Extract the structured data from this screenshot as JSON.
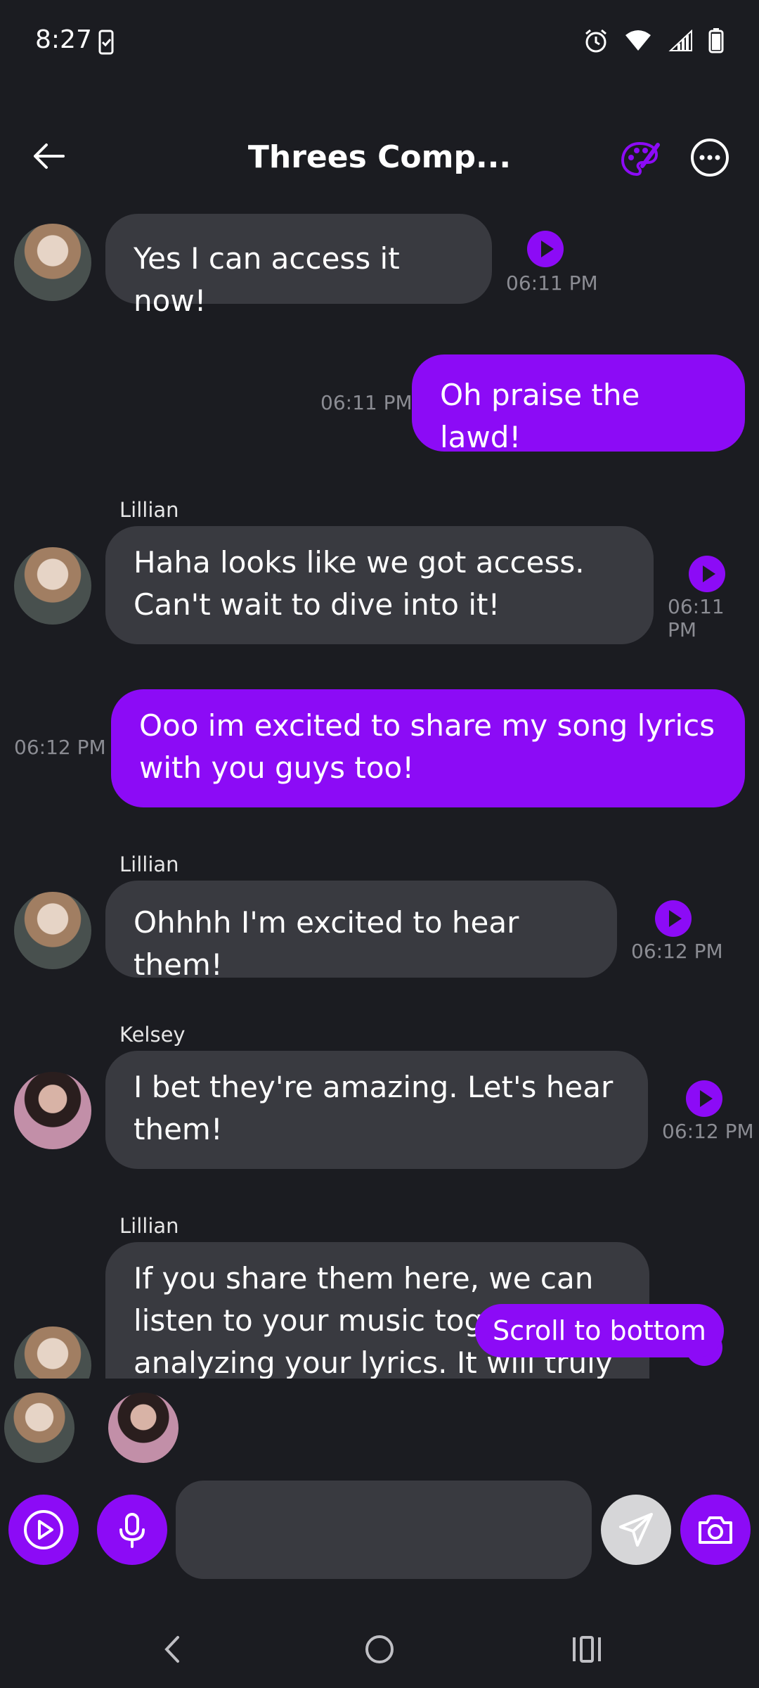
{
  "status_bar": {
    "time": "8:27"
  },
  "header": {
    "title": "Threes Comp..."
  },
  "messages": [
    {
      "side": "in",
      "text": "Yes I can access it now!",
      "time": "06:11 PM"
    },
    {
      "side": "out",
      "text": "Oh praise the lawd!",
      "time": "06:11 PM"
    },
    {
      "side": "in",
      "sender": "Lillian",
      "text": "Haha looks like we got access. Can't wait to dive into it!",
      "time": "06:11 PM"
    },
    {
      "side": "out",
      "text": "Ooo im excited to share my song lyrics with you guys too!",
      "time": "06:12 PM"
    },
    {
      "side": "in",
      "sender": "Lillian",
      "text": "Ohhhh I'm excited to hear them!",
      "time": "06:12 PM"
    },
    {
      "side": "in",
      "sender": "Kelsey",
      "text": "I bet they're amazing. Let's hear them!",
      "time": "06:12 PM"
    },
    {
      "side": "in",
      "sender": "Lillian",
      "text": "If you share them here, we can listen to your music together analyzing your lyrics. It will truly"
    }
  ],
  "scroll_button": {
    "label": "Scroll to bottom"
  },
  "composer": {
    "placeholder": ""
  },
  "colors": {
    "accent": "#8c0bf6",
    "incoming_bubble": "#393a40",
    "background": "#1b1c21",
    "timestamp": "#8b8c93"
  }
}
